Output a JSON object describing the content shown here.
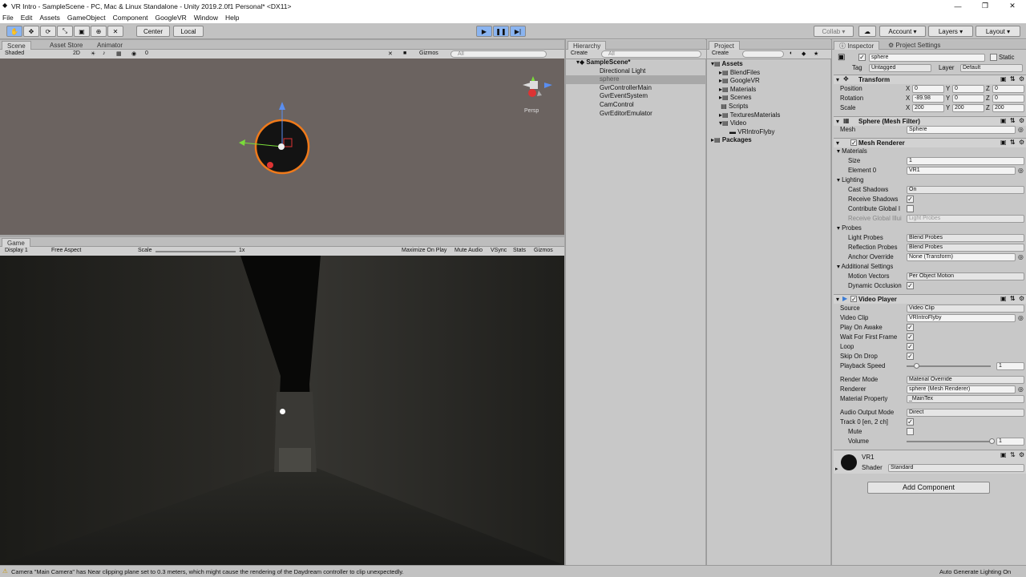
{
  "window": {
    "title": "VR Intro - SampleScene - PC, Mac & Linux Standalone - Unity 2019.2.0f1 Personal* <DX11>",
    "min": "—",
    "max": "❐",
    "close": "✕"
  },
  "menu": [
    "File",
    "Edit",
    "Assets",
    "GameObject",
    "Component",
    "GoogleVR",
    "Window",
    "Help"
  ],
  "toolbar": {
    "center": "Center",
    "local": "Local",
    "collab": "Collab ▾",
    "account": "Account",
    "layers": "Layers",
    "layout": "Layout",
    "cloud": "☁"
  },
  "scene_panel": {
    "tabs": [
      "Scene",
      "Asset Store",
      "Animator"
    ],
    "shading": "Shaded",
    "mode2d": "2D",
    "gizmos": "Gizmos",
    "search_placeholder": "All",
    "fx_count": "0",
    "persp": "Persp"
  },
  "game_panel": {
    "tab": "Game",
    "display": "Display 1",
    "aspect": "Free Aspect",
    "scale_label": "Scale",
    "scale_value": "1x",
    "buttons": [
      "Maximize On Play",
      "Mute Audio",
      "VSync",
      "Stats",
      "Gizmos"
    ]
  },
  "hierarchy": {
    "tab": "Hierarchy",
    "create": "Create",
    "search_placeholder": "All",
    "scene": "SampleScene*",
    "items": [
      "Directional Light",
      "sphere",
      "GvrControllerMain",
      "GvrEventSystem",
      "CamControl",
      "GvrEditorEmulator"
    ]
  },
  "project": {
    "tab": "Project",
    "create": "Create",
    "items": [
      "Assets",
      "BlendFiles",
      "GoogleVR",
      "Materials",
      "Scenes",
      "Scripts",
      "TexturesMaterials",
      "Video",
      "VRIntroFlyby",
      "Packages"
    ]
  },
  "inspector": {
    "tabs": [
      "Inspector",
      "Project Settings"
    ],
    "object_name": "sphere",
    "static": "Static",
    "tag_label": "Tag",
    "tag": "Untagged",
    "layer_label": "Layer",
    "layer": "Default",
    "transform": {
      "header": "Transform",
      "position_label": "Position",
      "rotation_label": "Rotation",
      "scale_label": "Scale",
      "axis": [
        "X",
        "Y",
        "Z"
      ],
      "position": [
        "0",
        "0",
        "0"
      ],
      "rotation": [
        "-89.98",
        "0",
        "0"
      ],
      "scale": [
        "200",
        "200",
        "200"
      ]
    },
    "mesh_filter": {
      "header": "Sphere (Mesh Filter)",
      "mesh_label": "Mesh",
      "mesh": "Sphere"
    },
    "mesh_renderer": {
      "header": "Mesh Renderer",
      "materials": "Materials",
      "size_label": "Size",
      "size": "1",
      "element0_label": "Element 0",
      "element0": "VR1",
      "lighting": "Lighting",
      "cast_shadows_label": "Cast Shadows",
      "cast_shadows": "On",
      "receive_shadows_label": "Receive Shadows",
      "contribute_gi_label": "Contribute Global I",
      "receive_gi_label": "Receive Global Illui",
      "receive_gi": "Light Probes",
      "probes": "Probes",
      "light_probes_label": "Light Probes",
      "light_probes": "Blend Probes",
      "reflection_probes_label": "Reflection Probes",
      "reflection_probes": "Blend Probes",
      "anchor_override_label": "Anchor Override",
      "anchor_override": "None (Transform)",
      "additional": "Additional Settings",
      "motion_vectors_label": "Motion Vectors",
      "motion_vectors": "Per Object Motion",
      "dynamic_occlusion_label": "Dynamic Occlusion"
    },
    "video_player": {
      "header": "Video Player",
      "source_label": "Source",
      "source": "Video Clip",
      "video_clip_label": "Video Clip",
      "video_clip": "VRIntroFlyby",
      "play_on_awake_label": "Play On Awake",
      "wait_first_frame_label": "Wait For First Frame",
      "loop_label": "Loop",
      "skip_on_drop_label": "Skip On Drop",
      "playback_speed_label": "Playback Speed",
      "playback_speed": "1",
      "render_mode_label": "Render Mode",
      "render_mode": "Material Override",
      "renderer_label": "Renderer",
      "renderer": "sphere (Mesh Renderer)",
      "material_property_label": "Material Property",
      "material_property": "_MainTex",
      "audio_output_label": "Audio Output Mode",
      "audio_output": "Direct",
      "track_label": "Track 0 [en, 2 ch]",
      "mute_label": "Mute",
      "volume_label": "Volume",
      "volume": "1"
    },
    "material": {
      "name": "VR1",
      "shader_label": "Shader",
      "shader": "Standard"
    },
    "add_component": "Add Component"
  },
  "status": {
    "message": "Camera \"Main Camera\" has Near clipping plane set to 0.3 meters, which might cause the rendering of the Daydream controller to clip unexpectedly.",
    "right": "Auto Generate Lighting On"
  },
  "colors": {
    "accent": "#3a7bd5",
    "selection_outline": "#f07a1a",
    "play_on": "#8ab4f0"
  }
}
